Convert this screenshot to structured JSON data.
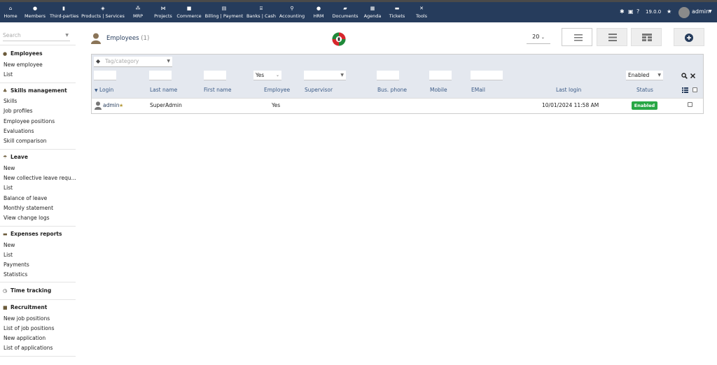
{
  "topnav": {
    "items": [
      {
        "label": "Home",
        "icon": "home-icon"
      },
      {
        "label": "Members",
        "icon": "members-icon"
      },
      {
        "label": "Third-parties",
        "icon": "building-icon"
      },
      {
        "label": "Products | Services",
        "icon": "cube-icon"
      },
      {
        "label": "MRP",
        "icon": "cubes-icon"
      },
      {
        "label": "Projects",
        "icon": "sitemap-icon"
      },
      {
        "label": "Commerce",
        "icon": "suitcase-icon"
      },
      {
        "label": "Billing | Payment",
        "icon": "invoice-icon"
      },
      {
        "label": "Banks | Cash",
        "icon": "bank-icon"
      },
      {
        "label": "Accounting",
        "icon": "search-dollar-icon"
      },
      {
        "label": "HRM",
        "icon": "user-tie-icon"
      },
      {
        "label": "Documents",
        "icon": "folder-icon"
      },
      {
        "label": "Agenda",
        "icon": "calendar-icon"
      },
      {
        "label": "Tickets",
        "icon": "ticket-icon"
      },
      {
        "label": "Tools",
        "icon": "tools-icon"
      }
    ],
    "version": "19.0.0",
    "user": "admin",
    "bar_color": "#263c5c"
  },
  "sidebar": {
    "search_placeholder": "Search",
    "groups": [
      {
        "title": "Employees",
        "links": [
          "New employee",
          "List"
        ]
      },
      {
        "title": "Skills management",
        "links": [
          "Skills",
          "Job profiles",
          "Employee positions",
          "Evaluations",
          "Skill comparison"
        ]
      },
      {
        "title": "Leave",
        "links": [
          "New",
          "New collective leave requ...",
          "List",
          "Balance of leave",
          "Monthly statement",
          "View change logs"
        ]
      },
      {
        "title": "Expenses reports",
        "links": [
          "New",
          "List",
          "Payments",
          "Statistics"
        ]
      },
      {
        "title": "Time tracking",
        "links": []
      },
      {
        "title": "Recruitment",
        "links": [
          "New job positions",
          "List of job positions",
          "New application",
          "List of applications"
        ]
      }
    ]
  },
  "page": {
    "title": "Employees",
    "count": "(1)",
    "page_size": "20"
  },
  "filters": {
    "tag_placeholder": "Tag/category",
    "employee_value": "Yes",
    "status_value": "Enabled"
  },
  "columns": {
    "login": "Login",
    "lastname": "Last name",
    "firstname": "First name",
    "employee": "Employee",
    "supervisor": "Supervisor",
    "bus_phone": "Bus. phone",
    "mobile": "Mobile",
    "email": "EMail",
    "last_login": "Last login",
    "status": "Status"
  },
  "rows": [
    {
      "login": "admin",
      "lastname": "SuperAdmin",
      "firstname": "",
      "employee": "Yes",
      "last_login": "10/01/2024 11:58 AM",
      "status": "Enabled"
    }
  ],
  "colors": {
    "accent": "#263c5c",
    "status_enabled": "#28a745",
    "filter_bg": "#e4e8ef"
  }
}
